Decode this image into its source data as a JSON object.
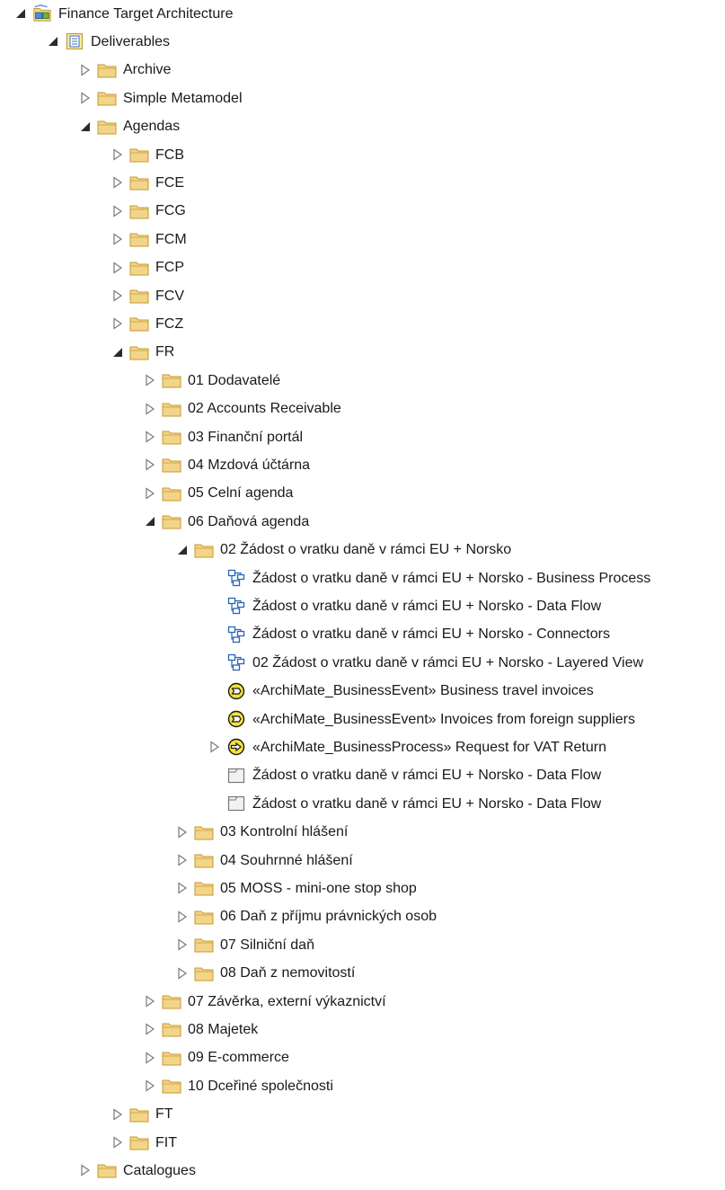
{
  "tree": [
    {
      "label": "Finance Target Architecture",
      "icon": "root-package-icon",
      "toggle": "expanded",
      "level": 0
    },
    {
      "label": "Deliverables",
      "icon": "package-icon",
      "toggle": "expanded",
      "level": 1
    },
    {
      "label": "Archive",
      "icon": "folder-icon",
      "toggle": "collapsed",
      "level": 2
    },
    {
      "label": "Simple Metamodel",
      "icon": "folder-icon",
      "toggle": "collapsed",
      "level": 2
    },
    {
      "label": "Agendas",
      "icon": "folder-icon",
      "toggle": "expanded",
      "level": 2
    },
    {
      "label": "FCB",
      "icon": "folder-icon",
      "toggle": "collapsed",
      "level": 3
    },
    {
      "label": "FCE",
      "icon": "folder-icon",
      "toggle": "collapsed",
      "level": 3
    },
    {
      "label": "FCG",
      "icon": "folder-icon",
      "toggle": "collapsed",
      "level": 3
    },
    {
      "label": "FCM",
      "icon": "folder-icon",
      "toggle": "collapsed",
      "level": 3
    },
    {
      "label": "FCP",
      "icon": "folder-icon",
      "toggle": "collapsed",
      "level": 3
    },
    {
      "label": "FCV",
      "icon": "folder-icon",
      "toggle": "collapsed",
      "level": 3
    },
    {
      "label": "FCZ",
      "icon": "folder-icon",
      "toggle": "collapsed",
      "level": 3
    },
    {
      "label": "FR",
      "icon": "folder-icon",
      "toggle": "expanded",
      "level": 3
    },
    {
      "label": "01 Dodavatelé",
      "icon": "folder-icon",
      "toggle": "collapsed",
      "level": 4
    },
    {
      "label": "02 Accounts Receivable",
      "icon": "folder-icon",
      "toggle": "collapsed",
      "level": 4
    },
    {
      "label": "03 Finanční portál",
      "icon": "folder-icon",
      "toggle": "collapsed",
      "level": 4
    },
    {
      "label": "04 Mzdová účtárna",
      "icon": "folder-icon",
      "toggle": "collapsed",
      "level": 4
    },
    {
      "label": "05 Celní agenda",
      "icon": "folder-icon",
      "toggle": "collapsed",
      "level": 4
    },
    {
      "label": "06 Daňová agenda",
      "icon": "folder-icon",
      "toggle": "expanded",
      "level": 4
    },
    {
      "label": "02 Žádost o vratku daně v rámci EU + Norsko",
      "icon": "folder-icon",
      "toggle": "expanded",
      "level": 5
    },
    {
      "label": "Žádost o vratku daně v rámci EU + Norsko - Business Process",
      "icon": "diagram-icon",
      "toggle": "none",
      "level": 6
    },
    {
      "label": "Žádost o vratku daně v rámci EU + Norsko - Data Flow",
      "icon": "diagram-icon",
      "toggle": "none",
      "level": 6
    },
    {
      "label": "Žádost o vratku daně v rámci EU + Norsko - Connectors",
      "icon": "diagram-icon",
      "toggle": "none",
      "level": 6
    },
    {
      "label": "02 Žádost o vratku daně v rámci EU + Norsko - Layered View",
      "icon": "diagram-icon",
      "toggle": "none",
      "level": 6
    },
    {
      "label": "«ArchiMate_BusinessEvent» Business travel invoices",
      "icon": "business-event-icon",
      "toggle": "none",
      "level": 6
    },
    {
      "label": "«ArchiMate_BusinessEvent» Invoices from foreign suppliers",
      "icon": "business-event-icon",
      "toggle": "none",
      "level": 6
    },
    {
      "label": "«ArchiMate_BusinessProcess» Request for VAT Return",
      "icon": "business-process-icon",
      "toggle": "collapsed",
      "level": 6
    },
    {
      "label": "Žádost o vratku daně v rámci EU + Norsko - Data Flow",
      "icon": "frame-icon",
      "toggle": "none",
      "level": 6
    },
    {
      "label": "Žádost o vratku daně v rámci EU + Norsko - Data Flow",
      "icon": "frame-icon",
      "toggle": "none",
      "level": 6
    },
    {
      "label": "03 Kontrolní hlášení",
      "icon": "folder-icon",
      "toggle": "collapsed",
      "level": 5
    },
    {
      "label": "04 Souhrnné hlášení",
      "icon": "folder-icon",
      "toggle": "collapsed",
      "level": 5
    },
    {
      "label": "05 MOSS - mini-one stop shop",
      "icon": "folder-icon",
      "toggle": "collapsed",
      "level": 5
    },
    {
      "label": "06 Daň z příjmu právnických osob",
      "icon": "folder-icon",
      "toggle": "collapsed",
      "level": 5
    },
    {
      "label": "07 Silniční daň",
      "icon": "folder-icon",
      "toggle": "collapsed",
      "level": 5
    },
    {
      "label": "08 Daň z nemovitostí",
      "icon": "folder-icon",
      "toggle": "collapsed",
      "level": 5
    },
    {
      "label": "07 Závěrka, externí výkaznictví",
      "icon": "folder-icon",
      "toggle": "collapsed",
      "level": 4
    },
    {
      "label": "08 Majetek",
      "icon": "folder-icon",
      "toggle": "collapsed",
      "level": 4
    },
    {
      "label": "09 E-commerce",
      "icon": "folder-icon",
      "toggle": "collapsed",
      "level": 4
    },
    {
      "label": "10 Dceřiné společnosti",
      "icon": "folder-icon",
      "toggle": "collapsed",
      "level": 4
    },
    {
      "label": "FT",
      "icon": "folder-icon",
      "toggle": "collapsed",
      "level": 3
    },
    {
      "label": "FIT",
      "icon": "folder-icon",
      "toggle": "collapsed",
      "level": 3
    },
    {
      "label": "Catalogues",
      "icon": "folder-icon",
      "toggle": "collapsed",
      "level": 2
    }
  ],
  "colors": {
    "folder_fill": "#f2d48a",
    "folder_stroke": "#c79a2e",
    "toggle_expanded": "#2b2b2b",
    "toggle_collapsed": "#7a7a7a",
    "diagram_blue": "#2a63b8",
    "event_yellow": "#f3e23a"
  }
}
